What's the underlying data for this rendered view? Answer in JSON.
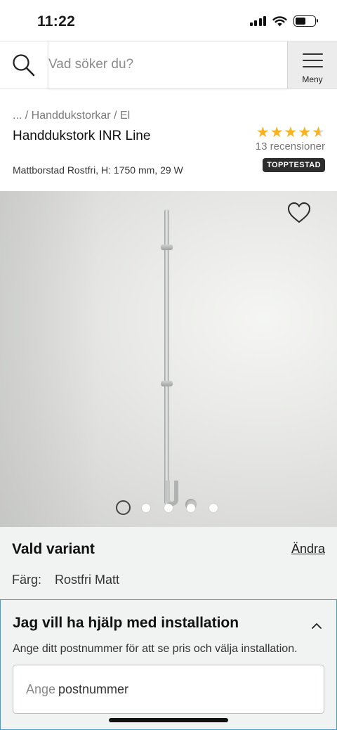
{
  "status_bar": {
    "time": "11:22",
    "signal_icon": "cellular-signal-icon",
    "wifi_icon": "wifi-icon",
    "battery_icon": "battery-icon",
    "battery_level": 0.55
  },
  "header": {
    "search_icon": "search-icon",
    "search_placeholder": "Vad söker du?",
    "menu_icon": "hamburger-icon",
    "menu_label": "Meny"
  },
  "product": {
    "breadcrumb": "... / Handdukstorkar / El",
    "title": "Handdukstork INR Line",
    "subtitle": "Mattborstad Rostfri, H: 1750 mm, 29 W",
    "rating": 4.5,
    "rating_max": 5,
    "review_count": "13 recensioner",
    "badge": "TOPPTESTAD",
    "star_color": "#f7b321"
  },
  "gallery": {
    "favorite_icon": "heart-outline-icon",
    "image_count": 5,
    "active_index": 0
  },
  "variant": {
    "title": "Vald variant",
    "change_link": "Ändra",
    "color_label": "Färg:",
    "color_value": "Rostfri Matt"
  },
  "installation": {
    "title": "Jag vill ha hjälp med installation",
    "chevron_icon": "chevron-up-icon",
    "description": "Ange ditt postnummer för att se pris och välja installation.",
    "postal_prefix": "Ange",
    "postal_placeholder": "postnummer",
    "accent_color": "#3f9ed1"
  }
}
